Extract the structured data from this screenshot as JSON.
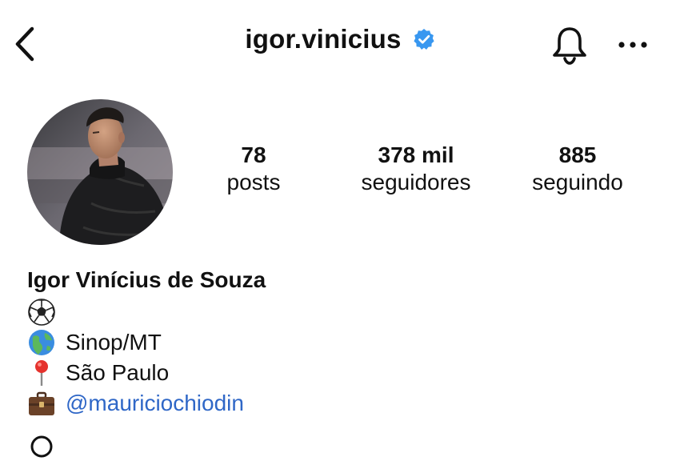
{
  "header": {
    "username": "igor.vinicius",
    "verified": true
  },
  "icons": {
    "back": "chevron-left-icon",
    "verified": "verified-badge-icon",
    "notifications": "bell-icon",
    "more": "more-horizontal-icon"
  },
  "stats": {
    "posts": {
      "value": "78",
      "label": "posts"
    },
    "followers": {
      "value": "378 mil",
      "label": "seguidores"
    },
    "following": {
      "value": "885",
      "label": "seguindo"
    }
  },
  "profile": {
    "full_name": "Igor Vinícius de Souza",
    "bio": [
      {
        "emoji": "soccer-ball-icon",
        "text": ""
      },
      {
        "emoji": "globe-icon",
        "text": "Sinop/MT"
      },
      {
        "emoji": "pin-icon",
        "text": "São Paulo"
      },
      {
        "emoji": "briefcase-icon",
        "text": "@mauriciochiodin"
      }
    ]
  },
  "colors": {
    "link": "#2f67c7",
    "verified": "#3897f0",
    "text": "#111111"
  }
}
